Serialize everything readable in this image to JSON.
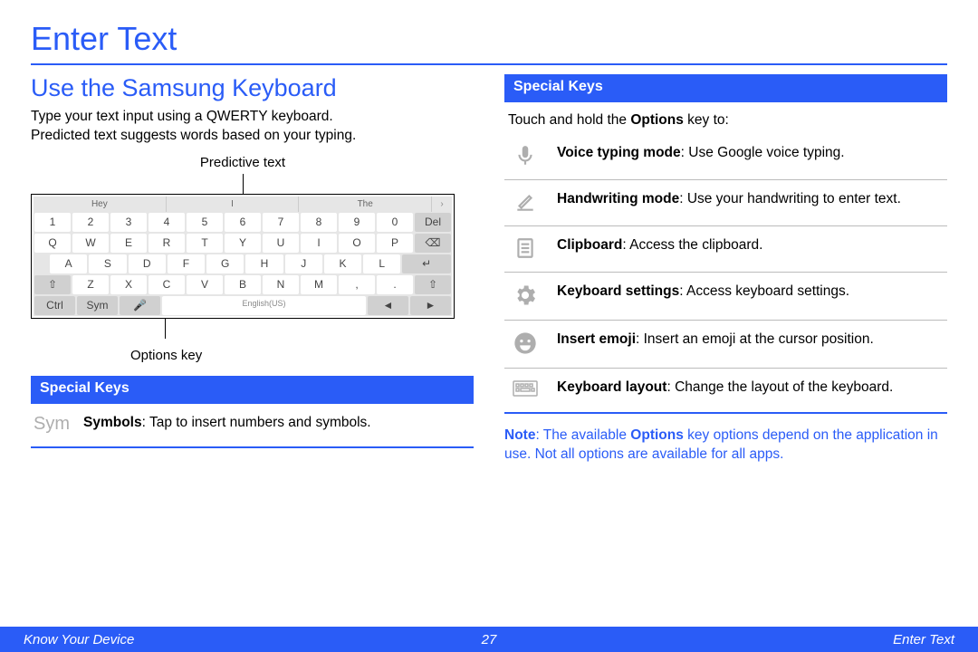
{
  "title": "Enter Text",
  "section_heading": "Use the Samsung Keyboard",
  "intro_line1": "Type your text input using a QWERTY keyboard.",
  "intro_line2": "Predicted text suggests words based on your typing.",
  "callout_top": "Predictive text",
  "callout_bottom": "Options key",
  "keyboard": {
    "predict": [
      "Hey",
      "I",
      "The",
      "›"
    ],
    "row_num": [
      {
        "k": "1"
      },
      {
        "k": "2"
      },
      {
        "k": "3"
      },
      {
        "k": "4"
      },
      {
        "k": "5"
      },
      {
        "k": "6"
      },
      {
        "k": "7"
      },
      {
        "k": "8"
      },
      {
        "k": "9"
      },
      {
        "k": "0"
      },
      {
        "k": "Del",
        "g": true
      }
    ],
    "row_q": [
      {
        "k": "Q"
      },
      {
        "k": "W"
      },
      {
        "k": "E"
      },
      {
        "k": "R"
      },
      {
        "k": "T"
      },
      {
        "k": "Y"
      },
      {
        "k": "U"
      },
      {
        "k": "I"
      },
      {
        "k": "O"
      },
      {
        "k": "P"
      },
      {
        "k": "⌫",
        "g": true
      }
    ],
    "row_a": [
      {
        "k": "A"
      },
      {
        "k": "S"
      },
      {
        "k": "D"
      },
      {
        "k": "F"
      },
      {
        "k": "G"
      },
      {
        "k": "H"
      },
      {
        "k": "J"
      },
      {
        "k": "K"
      },
      {
        "k": "L"
      },
      {
        "k": "↵",
        "g": true,
        "w": true
      }
    ],
    "row_z": [
      {
        "k": "⇧",
        "g": true
      },
      {
        "k": "Z"
      },
      {
        "k": "X"
      },
      {
        "k": "C"
      },
      {
        "k": "V"
      },
      {
        "k": "B"
      },
      {
        "k": "N"
      },
      {
        "k": "M"
      },
      {
        "k": ","
      },
      {
        "k": "."
      },
      {
        "k": "⇧",
        "g": true
      }
    ],
    "row_bot": [
      {
        "k": "Ctrl",
        "g": true
      },
      {
        "k": "Sym",
        "g": true
      },
      {
        "k": "🎤",
        "g": true
      },
      {
        "k": "English(US)",
        "space": true
      },
      {
        "k": "◄",
        "g": true
      },
      {
        "k": "►",
        "g": true
      }
    ]
  },
  "left_header": "Special Keys",
  "left_item_icon": "Sym",
  "left_item_label": "Symbols",
  "left_item_text": ": Tap to insert numbers and symbols.",
  "right_header": "Special Keys",
  "right_intro_a": "Touch and hold the ",
  "right_intro_b": "Options",
  "right_intro_c": " key to:",
  "right_items": [
    {
      "label": "Voice typing mode",
      "text": ": Use Google voice typing."
    },
    {
      "label": "Handwriting mode",
      "text": ": Use your handwriting to enter text."
    },
    {
      "label": "Clipboard",
      "text": ": Access the clipboard."
    },
    {
      "label": "Keyboard settings",
      "text": ": Access keyboard settings."
    },
    {
      "label": "Insert emoji",
      "text": ": Insert an emoji at the cursor position."
    },
    {
      "label": "Keyboard layout",
      "text": ": Change the layout of the keyboard."
    }
  ],
  "note_label": "Note",
  "note_a": ": The available ",
  "note_b": "Options",
  "note_c": " key options depend on the application in use. Not all options are available for all apps.",
  "footer": {
    "left": "Know Your Device",
    "mid": "27",
    "right": "Enter Text"
  }
}
